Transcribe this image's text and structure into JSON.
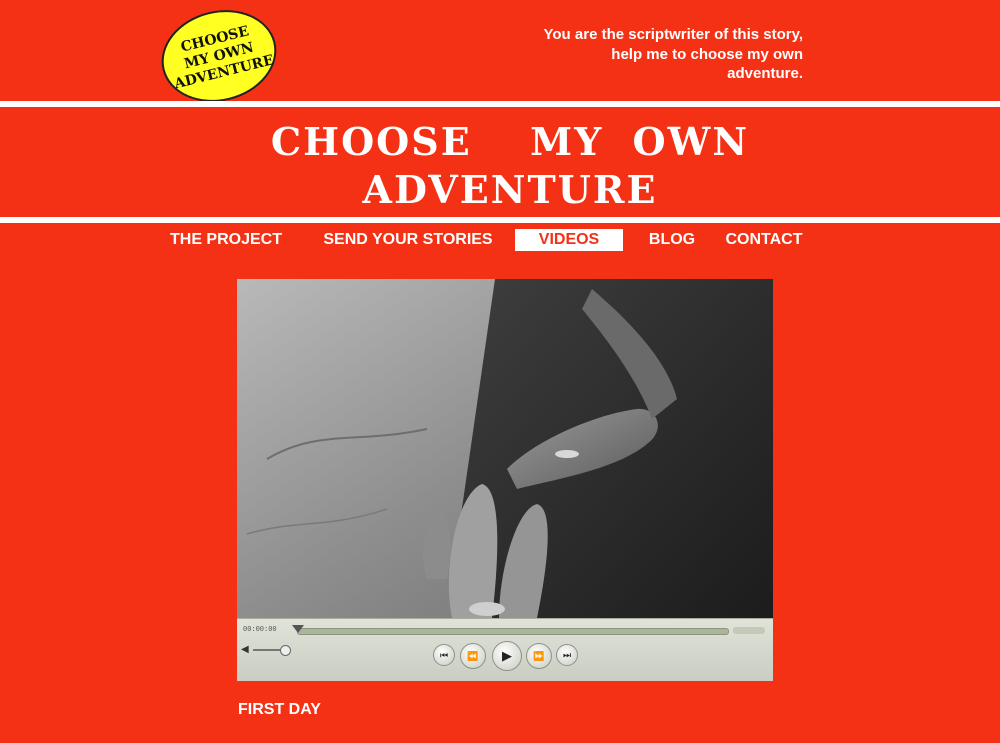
{
  "logo": {
    "line1": "CHOOSE",
    "line2": "MY OWN",
    "line3": "ADVENTURE"
  },
  "tagline": "You are the scriptwriter of this story, help me to choose my own adventure.",
  "title": {
    "line1": "CHOOSE  MY OWN",
    "line2": "ADVENTURE"
  },
  "nav": {
    "items": [
      {
        "label": "THE PROJECT",
        "active": false
      },
      {
        "label": "SEND YOUR STORIES",
        "active": false
      },
      {
        "label": "VIDEOS",
        "active": true
      },
      {
        "label": "BLOG",
        "active": false
      },
      {
        "label": "CONTACT",
        "active": false
      }
    ]
  },
  "video": {
    "timecode": "00:00:00",
    "progress": 0.0,
    "controls": [
      "skip-back-icon",
      "rewind-icon",
      "play-icon",
      "fast-forward-icon",
      "skip-forward-icon"
    ]
  },
  "caption": "FIRST DAY",
  "colors": {
    "background": "#f43114",
    "logo": "#ffff22",
    "text": "#ffffff"
  }
}
